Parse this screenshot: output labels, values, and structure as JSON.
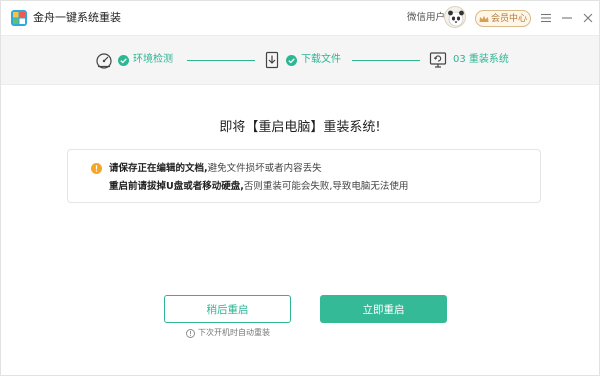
{
  "app": {
    "title": "金舟一键系统重装",
    "user_name": "微信用户",
    "vip_label": "会员中心"
  },
  "steps": [
    {
      "label": "环境检测",
      "icon": "gauge-icon",
      "status": "done"
    },
    {
      "label": "下载文件",
      "icon": "download-file-icon",
      "status": "done"
    },
    {
      "label": "03 重装系统",
      "icon": "monitor-refresh-icon",
      "status": "active"
    }
  ],
  "main": {
    "headline": "即将【重启电脑】重装系统!",
    "notice": {
      "line1_bold": "请保存正在编辑的文档,",
      "line1_rest": "避免文件损坏或者内容丢失",
      "line2_bold": "重启前请拔掉U盘或者移动硬盘,",
      "line2_rest": "否则重装可能会失败,导致电脑无法使用"
    },
    "later_button": "稍后重启",
    "now_button": "立即重启",
    "auto_note": "下次开机时自动重装"
  },
  "colors": {
    "accent": "#35ba97",
    "step_green": "#2db594",
    "warning": "#f5a623",
    "vip_border": "#d8b98a"
  }
}
